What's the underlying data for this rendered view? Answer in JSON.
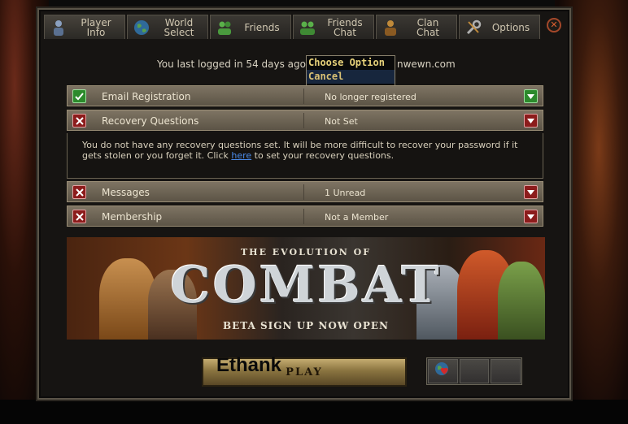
{
  "tabs": [
    {
      "label": "Player\nInfo",
      "icon": "player-icon",
      "active": true
    },
    {
      "label": "World\nSelect",
      "icon": "globe-icon"
    },
    {
      "label": "Friends",
      "icon": "friends-icon"
    },
    {
      "label": "Friends\nChat",
      "icon": "friends-chat-icon"
    },
    {
      "label": "Clan\nChat",
      "icon": "clan-chat-icon"
    },
    {
      "label": "Options",
      "icon": "wrench-icon"
    }
  ],
  "close_symbol": "✕",
  "last_login": {
    "prefix": "You last logged in 54 days ago",
    "suffix": "nwewn.com"
  },
  "dropdown": {
    "title": "Choose Option",
    "cancel": "Cancel"
  },
  "rows": {
    "email": {
      "label": "Email Registration",
      "value": "No longer registered",
      "status": "ok"
    },
    "recovery": {
      "label": "Recovery Questions",
      "value": "Not Set",
      "status": "bad"
    },
    "messages": {
      "label": "Messages",
      "value": "1 Unread",
      "status": "bad"
    },
    "membership": {
      "label": "Membership",
      "value": "Not a Member",
      "status": "bad"
    }
  },
  "recovery_text": {
    "before": "You do not have any recovery questions set. It will be more difficult to recover your password if it gets stolen or you forget it. Click ",
    "link": "here",
    "after": " to set your recovery questions."
  },
  "banner": {
    "subtitle": "THE EVOLUTION OF",
    "title": "COMBAT",
    "cta": "BETA SIGN UP NOW OPEN"
  },
  "play_label": "PLAY",
  "username": "Ethank",
  "colors": {
    "status_ok": "#2c8a2c",
    "status_bad": "#8c1c1c",
    "link": "#4a8ae8"
  }
}
